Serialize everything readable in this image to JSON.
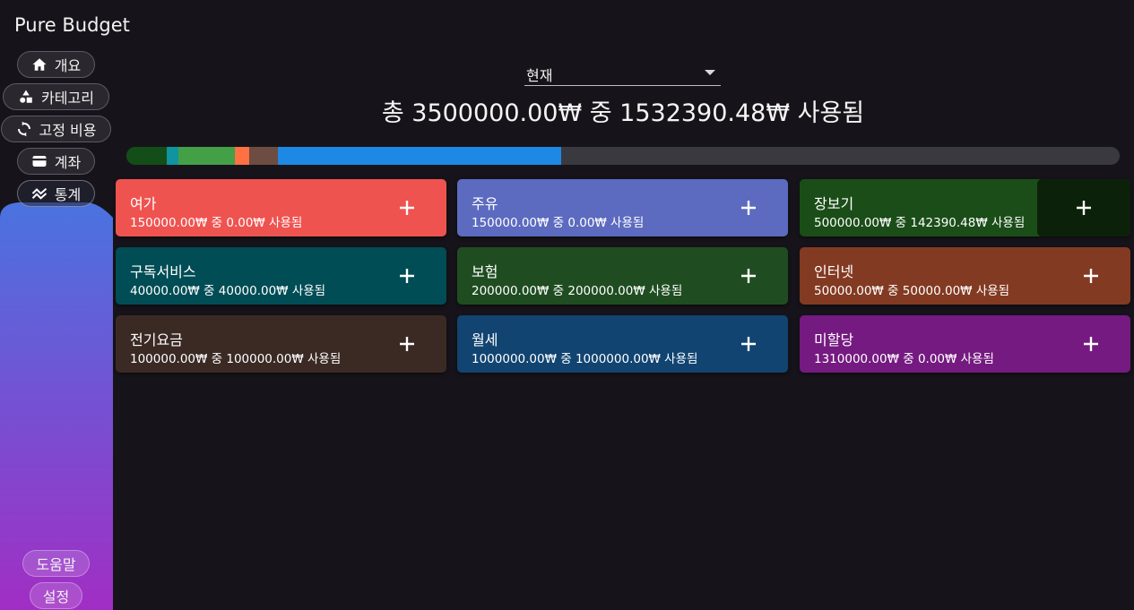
{
  "app": {
    "title": "Pure Budget"
  },
  "nav": {
    "overview": "개요",
    "categories": "카테고리",
    "fixed_costs": "고정 비용",
    "accounts": "계좌",
    "statistics": "통계",
    "help": "도움말",
    "settings": "설정"
  },
  "header": {
    "period_value": "현재",
    "summary": "총 3500000.00₩ 중 1532390.48₩ 사용됨"
  },
  "colors": {
    "bar_track": "#3a3940",
    "sidebar_gradient_top": "#4a73e0",
    "sidebar_gradient_bottom": "#a12ec4"
  },
  "budget_bar": [
    {
      "category": "장보기",
      "fraction": 0.0407,
      "color": "#134d17"
    },
    {
      "category": "구독서비스",
      "fraction": 0.0114,
      "color": "#0f94a0"
    },
    {
      "category": "보험",
      "fraction": 0.0571,
      "color": "#43a047"
    },
    {
      "category": "인터넷",
      "fraction": 0.0143,
      "color": "#ff7043"
    },
    {
      "category": "전기요금",
      "fraction": 0.0286,
      "color": "#6d4c41"
    },
    {
      "category": "월세",
      "fraction": 0.2857,
      "color": "#1e88e5"
    }
  ],
  "cards": [
    {
      "name": "여가",
      "usage": "150000.00₩ 중 0.00₩ 사용됨",
      "color": "#ef5350"
    },
    {
      "name": "주유",
      "usage": "150000.00₩ 중 0.00₩ 사용됨",
      "color": "#5c6bc0"
    },
    {
      "name": "장보기",
      "usage": "500000.00₩ 중 142390.48₩ 사용됨",
      "color": "#1b4d18"
    },
    {
      "name": "구독서비스",
      "usage": "40000.00₩ 중 40000.00₩ 사용됨",
      "color": "#004d55"
    },
    {
      "name": "보험",
      "usage": "200000.00₩ 중 200000.00₩ 사용됨",
      "color": "#1f4d21"
    },
    {
      "name": "인터넷",
      "usage": "50000.00₩ 중 50000.00₩ 사용됨",
      "color": "#833a22"
    },
    {
      "name": "전기요금",
      "usage": "100000.00₩ 중 100000.00₩ 사용됨",
      "color": "#3b2a24"
    },
    {
      "name": "월세",
      "usage": "1000000.00₩ 중 1000000.00₩ 사용됨",
      "color": "#114471"
    },
    {
      "name": "미할당",
      "usage": "1310000.00₩ 중 0.00₩ 사용됨",
      "color": "#751a80"
    }
  ]
}
